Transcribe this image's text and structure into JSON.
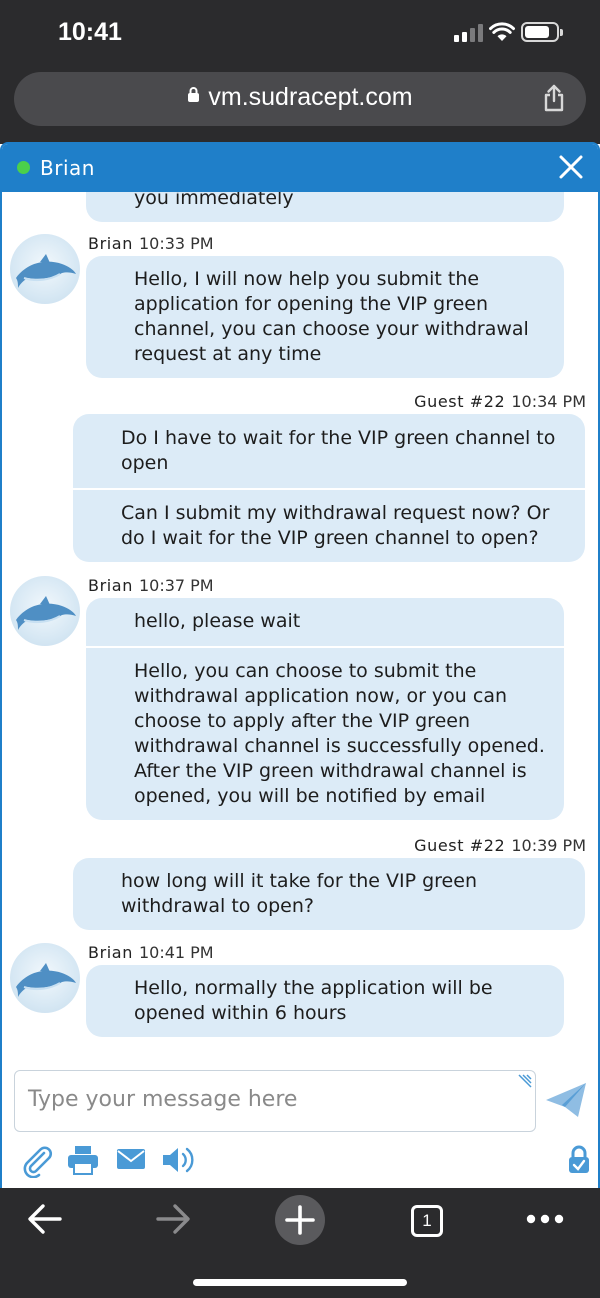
{
  "status_bar": {
    "time": "10:41"
  },
  "url_bar": {
    "domain": "vm.sudracept.com"
  },
  "chat": {
    "header_name": "Brian",
    "messages": [
      {
        "sender": "Brian",
        "time": "",
        "texts": [
          "you immediately"
        ]
      },
      {
        "sender": "Brian",
        "time": "10:33 PM",
        "texts": [
          "Hello, I will now help you submit the application for opening the VIP green channel, you can choose your withdrawal request at any time"
        ]
      },
      {
        "sender": "Guest #22",
        "time": "10:34 PM",
        "texts": [
          "Do I have to wait for the VIP green channel to open",
          "Can I submit my withdrawal request now? Or do I wait for the VIP green channel to open?"
        ]
      },
      {
        "sender": "Brian",
        "time": "10:37 PM",
        "texts": [
          "hello, please wait",
          "Hello, you can choose to submit the withdrawal application now, or you can choose to apply after the VIP green withdrawal channel is successfully opened. After the VIP green withdrawal channel is opened, you will be notified by email"
        ]
      },
      {
        "sender": "Guest #22",
        "time": "10:39 PM",
        "texts": [
          "how long will it take for the VIP green withdrawal to open?"
        ]
      },
      {
        "sender": "Brian",
        "time": "10:41 PM",
        "texts": [
          "Hello, normally the application will be opened within 6 hours"
        ]
      }
    ],
    "input_placeholder": "Type your message here"
  },
  "browser_bottom": {
    "tab_count": "1"
  },
  "colors": {
    "header": "#1f7fc9",
    "bubble": "#dcebf7",
    "online": "#4bd04b",
    "tool_icons": "#4a9ad6"
  },
  "icons": [
    "lock-icon",
    "share-icon",
    "close-icon",
    "dolphin-avatar",
    "send-icon",
    "attach-icon",
    "print-icon",
    "email-icon",
    "sound-icon",
    "secure-lock-icon",
    "back-icon",
    "forward-icon",
    "new-tab-icon",
    "tabs-icon",
    "more-icon"
  ]
}
